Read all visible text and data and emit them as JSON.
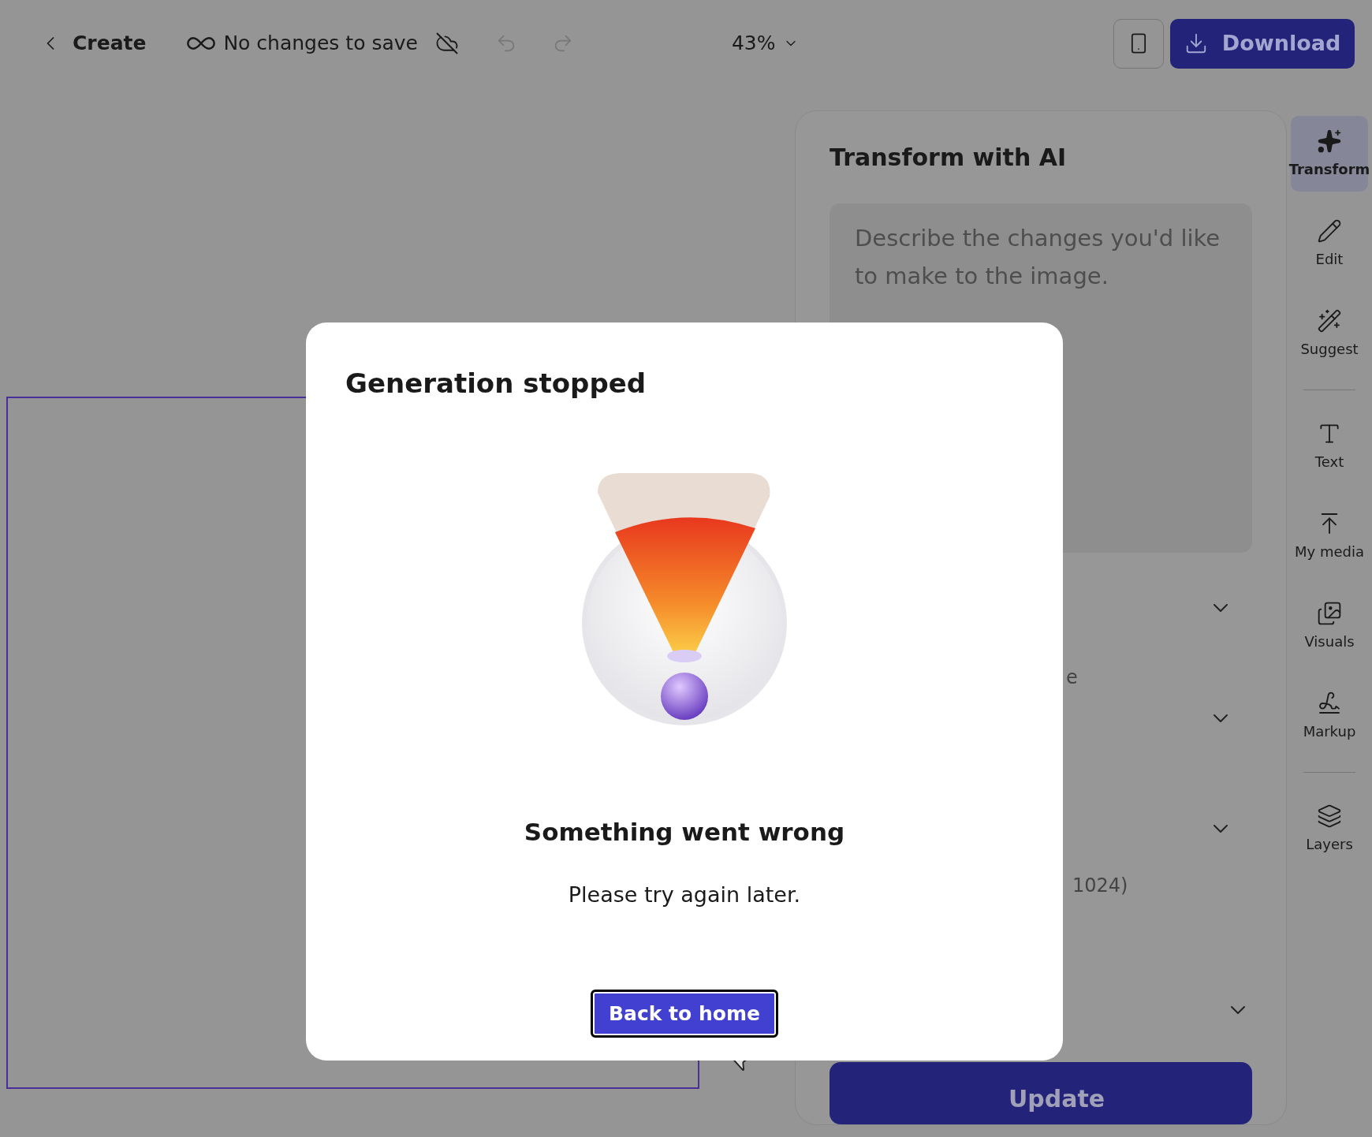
{
  "top_bar": {
    "back_label": "Create",
    "save_status": "No changes to save",
    "zoom": "43%",
    "download_label": "Download"
  },
  "panel": {
    "title": "Transform with AI",
    "prompt_placeholder": "Describe the changes you'd like\nto make to the image.",
    "partial_texts": [
      "e",
      "1024)"
    ],
    "update_label": "Update"
  },
  "rail": {
    "groups": [
      [
        {
          "label": "Transform",
          "selected": true
        },
        {
          "label": "Edit",
          "selected": false
        },
        {
          "label": "Suggest",
          "selected": false
        }
      ],
      [
        {
          "label": "Text",
          "selected": false
        },
        {
          "label": "My media",
          "selected": false
        },
        {
          "label": "Visuals",
          "selected": false
        },
        {
          "label": "Markup",
          "selected": false
        }
      ],
      [
        {
          "label": "Layers",
          "selected": false
        }
      ]
    ]
  },
  "dialog": {
    "title": "Generation stopped",
    "heading": "Something went wrong",
    "message": "Please try again later.",
    "button": "Back to home"
  }
}
